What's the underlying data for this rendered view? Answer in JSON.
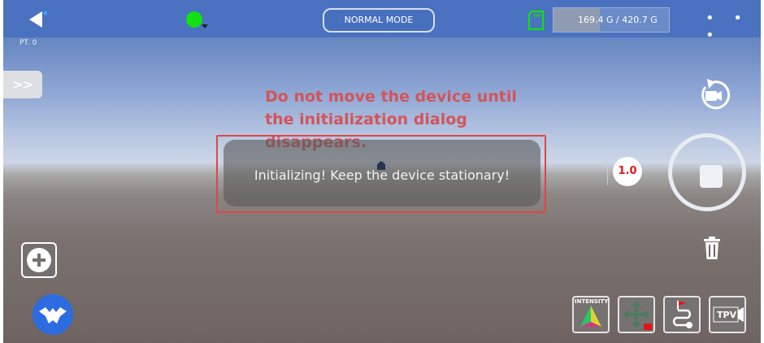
{
  "topbar": {
    "mode_label": "NORMAL MODE",
    "storage_text": "169.4 G / 420.7 G",
    "storage_used": 169.4,
    "storage_total": 420.7,
    "more_label": "• • •",
    "status_color": "#12e014"
  },
  "hud": {
    "pt_label": "PT. 0",
    "expand_label": ">>",
    "zoom_value": "1.0"
  },
  "warning": {
    "text": "Do not move the device until the initialization dialog disappears."
  },
  "dialog": {
    "message": "Initializing! Keep the device stationary!"
  },
  "toolbar": {
    "intensity_label": "INTENSITY",
    "tpv_label": "TPV"
  },
  "colors": {
    "accent_red": "#e04646",
    "warning_text": "#d2555a",
    "logo_blue": "#2d6be0"
  },
  "icons": [
    "back-arrow-icon",
    "status-dot-icon",
    "sd-card-icon",
    "rotate-camera-icon",
    "record-icon",
    "trash-icon",
    "plus-icon",
    "app-logo-icon",
    "intensity-icon",
    "move-icon",
    "path-flag-icon",
    "tpv-camera-icon"
  ]
}
